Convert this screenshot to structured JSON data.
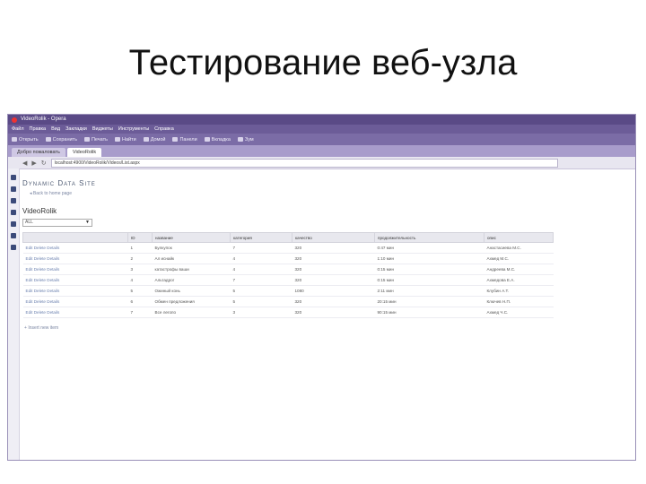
{
  "slide": {
    "title": "Тестирование веб-узла"
  },
  "browser": {
    "window_title": "VideoRolik - Opera",
    "menu": [
      "Файл",
      "Правка",
      "Вид",
      "Закладки",
      "Виджеты",
      "Инструменты",
      "Справка"
    ],
    "toolbar": [
      "Открыть",
      "Сохранить",
      "Печать",
      "Найти",
      "Домой",
      "Панели",
      "Вкладка",
      "Зум"
    ],
    "tabs": [
      "Добро пожаловать",
      "VideoRolik"
    ],
    "address": "localhost:4900/VideoRolik/Videos/List.aspx"
  },
  "page": {
    "site_title": "Dynamic Data Site",
    "back_link": "Back to home page",
    "heading": "VideoRolik",
    "filter_value": "ALL",
    "columns": [
      "ID",
      "название",
      "категория",
      "качество",
      "продолжительность",
      "опис"
    ],
    "actions": [
      "Edit",
      "Delete",
      "Details"
    ],
    "rows": [
      [
        "1",
        "Булкупок",
        "7",
        "320",
        "0:47 мин",
        "Анастасиева М.С."
      ],
      [
        "2",
        "Ал иснайк",
        "4",
        "320",
        "1:10 мин",
        "Ахмед М.С."
      ],
      [
        "3",
        "катастрофы ваши",
        "4",
        "320",
        "0:15 мин",
        "Андреева М.С."
      ],
      [
        "4",
        "Альтадрог",
        "7",
        "320",
        "0:15 мин",
        "Ахмедова Е.А."
      ],
      [
        "5",
        "Ожиный конь",
        "5",
        "1080",
        "2:11 мин",
        "Клубин А.Т."
      ],
      [
        "6",
        "Обмен предложения",
        "5",
        "320",
        "20:15 мин",
        "Ключев Н.П."
      ],
      [
        "7",
        "Все легопо",
        "3",
        "320",
        "90:15 мин",
        "Ахмед Ч.С."
      ]
    ],
    "insert_link": "Insert new item"
  }
}
